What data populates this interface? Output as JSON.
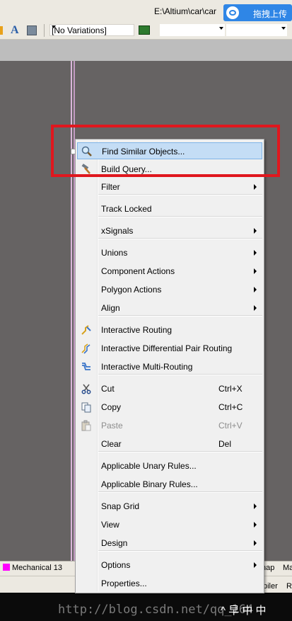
{
  "window": {
    "path_text": "E:\\Altium\\car\\car",
    "ocr_button_label": "拖拽上传",
    "variations_value": "[No Variations]"
  },
  "bottom_tabs": {
    "mechanical": "Mechanical 13",
    "nap": "nap",
    "ma": "Ma",
    "piler": "piler",
    "r": "R"
  },
  "watermark": "http://blog.csdn.net/qq_164",
  "tray": "^ 早 中 中",
  "menu": {
    "items": [
      {
        "label": "Find Similar Objects...",
        "shortcut": "",
        "submenu": false,
        "icon": "magnifier-icon"
      },
      {
        "label": "Build Query...",
        "shortcut": "",
        "submenu": false,
        "icon": "hammer-icon"
      },
      {
        "label": "Filter",
        "shortcut": "",
        "submenu": true,
        "icon": ""
      },
      {
        "label": "Track Locked",
        "shortcut": "",
        "submenu": false,
        "icon": ""
      },
      {
        "label": "xSignals",
        "shortcut": "",
        "submenu": true,
        "icon": ""
      },
      {
        "label": "Unions",
        "shortcut": "",
        "submenu": true,
        "icon": ""
      },
      {
        "label": "Component Actions",
        "shortcut": "",
        "submenu": true,
        "icon": ""
      },
      {
        "label": "Polygon Actions",
        "shortcut": "",
        "submenu": true,
        "icon": ""
      },
      {
        "label": "Align",
        "shortcut": "",
        "submenu": true,
        "icon": ""
      },
      {
        "label": "Interactive Routing",
        "shortcut": "",
        "submenu": false,
        "icon": "route-icon"
      },
      {
        "label": "Interactive Differential Pair Routing",
        "shortcut": "",
        "submenu": false,
        "icon": "diffpair-route-icon"
      },
      {
        "label": "Interactive Multi-Routing",
        "shortcut": "",
        "submenu": false,
        "icon": "multi-route-icon"
      },
      {
        "label": "Cut",
        "shortcut": "Ctrl+X",
        "submenu": false,
        "icon": "scissors-icon"
      },
      {
        "label": "Copy",
        "shortcut": "Ctrl+C",
        "submenu": false,
        "icon": "copy-icon"
      },
      {
        "label": "Paste",
        "shortcut": "Ctrl+V",
        "submenu": false,
        "icon": "paste-icon",
        "disabled": true
      },
      {
        "label": "Clear",
        "shortcut": "Del",
        "submenu": false,
        "icon": ""
      },
      {
        "label": "Applicable Unary Rules...",
        "shortcut": "",
        "submenu": false,
        "icon": ""
      },
      {
        "label": "Applicable Binary Rules...",
        "shortcut": "",
        "submenu": false,
        "icon": ""
      },
      {
        "label": "Snap Grid",
        "shortcut": "",
        "submenu": true,
        "icon": ""
      },
      {
        "label": "View",
        "shortcut": "",
        "submenu": true,
        "icon": ""
      },
      {
        "label": "Design",
        "shortcut": "",
        "submenu": true,
        "icon": ""
      },
      {
        "label": "Options",
        "shortcut": "",
        "submenu": true,
        "icon": ""
      },
      {
        "label": "Properties...",
        "shortcut": "",
        "submenu": false,
        "icon": ""
      }
    ]
  }
}
